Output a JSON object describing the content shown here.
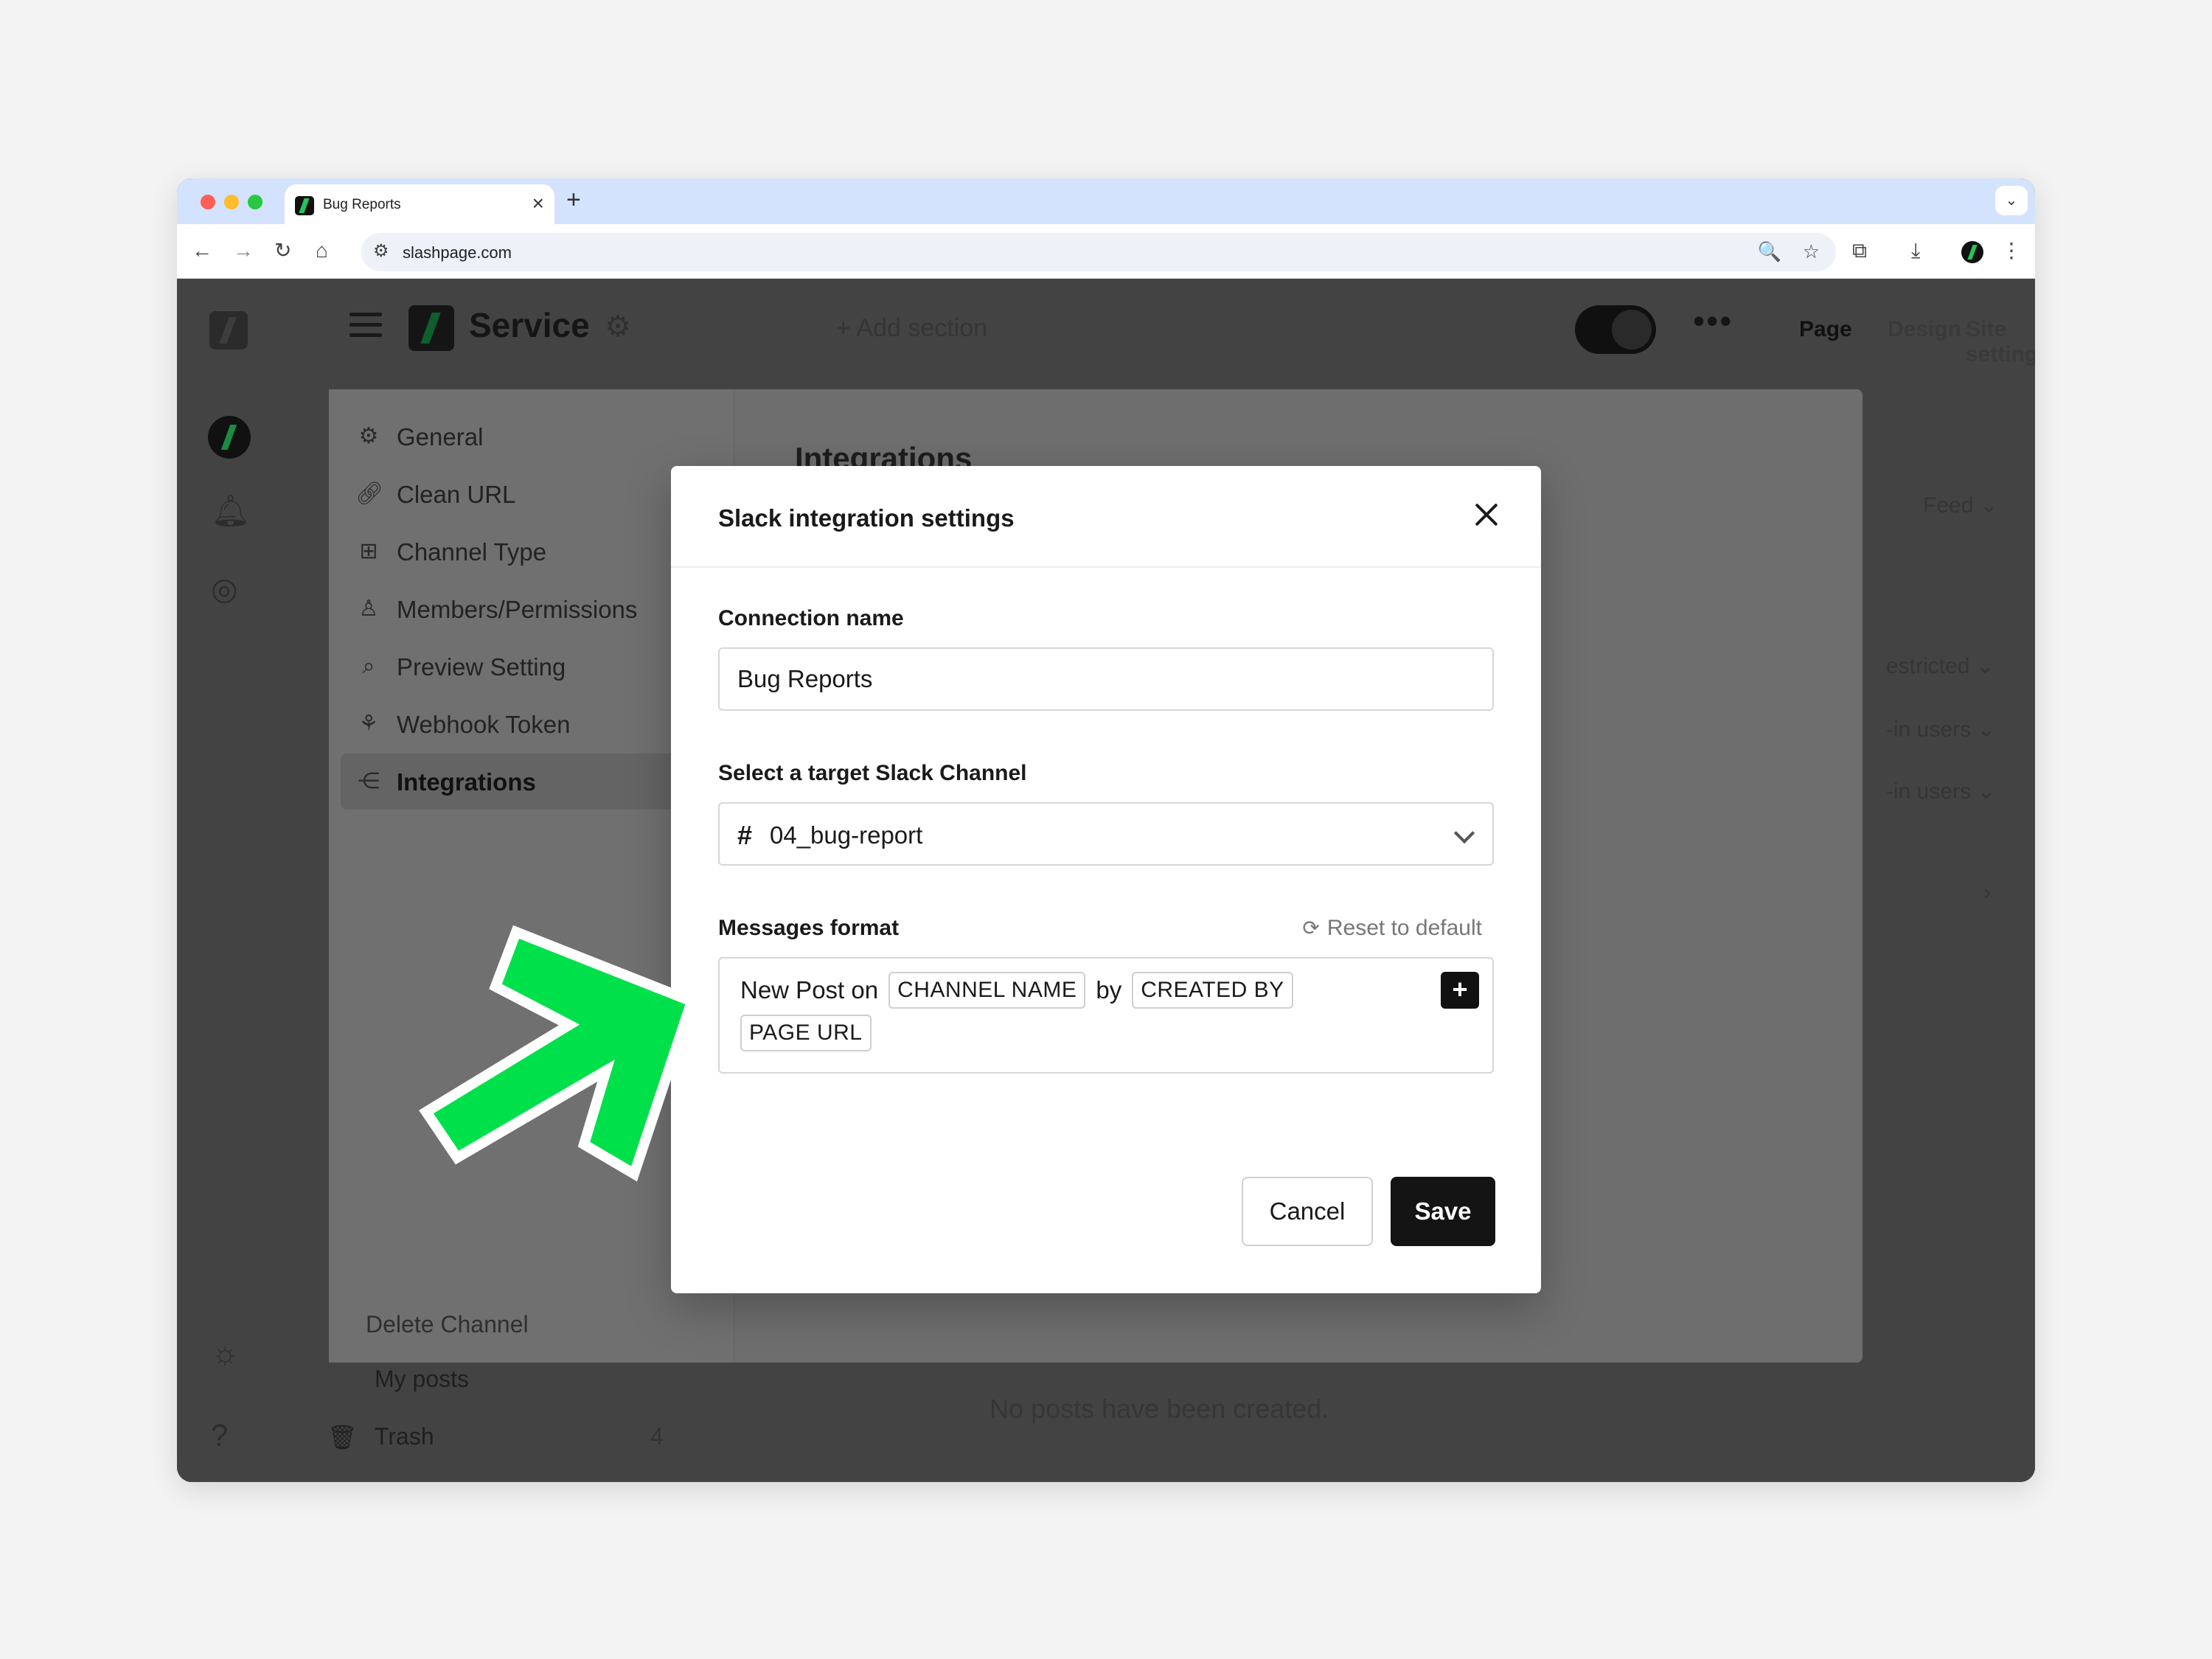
{
  "browser": {
    "tab_title": "Bug Reports",
    "tab_close": "×",
    "new_tab": "+",
    "url": "slashpage.com",
    "tab_dropdown": "⌄",
    "traffic_colors": [
      "#ff5f57",
      "#febc2e",
      "#28c840"
    ]
  },
  "app": {
    "title": "Service",
    "add_section": "+ Add section",
    "more": "•••",
    "header_tabs": [
      "Page",
      "Design",
      "Site settings"
    ],
    "right_panel": {
      "feed": "Feed ⌄",
      "restricted": "estricted ⌄",
      "logged_in_1": "-in users ⌄",
      "logged_in_2": "-in users ⌄",
      "chevron": "›"
    },
    "bottom_nav": {
      "my_posts": "My posts",
      "trash": "Trash",
      "trash_count": "4"
    },
    "empty_state": "No posts have been created."
  },
  "settings": {
    "heading": "Integrations",
    "items": [
      {
        "label": "General",
        "icon": "gear-icon"
      },
      {
        "label": "Clean URL",
        "icon": "link-icon"
      },
      {
        "label": "Channel Type",
        "icon": "layout-icon"
      },
      {
        "label": "Members/Permissions",
        "icon": "user-icon"
      },
      {
        "label": "Preview Setting",
        "icon": "preview-icon"
      },
      {
        "label": "Webhook Token",
        "icon": "webhook-icon"
      },
      {
        "label": "Integrations",
        "icon": "integrations-icon"
      }
    ],
    "active_item": "Integrations",
    "delete_channel": "Delete Channel"
  },
  "modal": {
    "title": "Slack integration settings",
    "connection_label": "Connection name",
    "connection_value": "Bug Reports",
    "channel_label": "Select a target Slack Channel",
    "channel_hash": "#",
    "channel_value": "04_bug-report",
    "format_label": "Messages format",
    "reset_label": "Reset to default",
    "format": {
      "text_new_post_on": "New Post on",
      "token_channel_name": "CHANNEL NAME",
      "text_by": "by",
      "token_created_by": "CREATED BY",
      "token_page_url": "PAGE URL",
      "add_token": "+"
    },
    "cancel_label": "Cancel",
    "save_label": "Save"
  },
  "colors": {
    "accent_green": "#00e04a",
    "primary_button": "#141414"
  }
}
